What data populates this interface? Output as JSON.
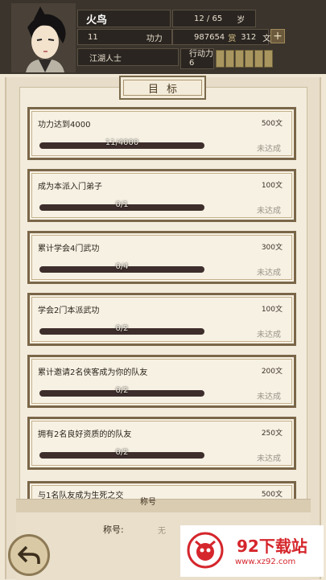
{
  "player": {
    "name": "火鸟",
    "age": "12 / 65",
    "age_unit": "岁",
    "level": "11",
    "power_label": "功力",
    "power": "987654",
    "currency_label": "赏",
    "coins": "312",
    "coin_unit": "文",
    "identity": "江湖人士",
    "action_label": "行动力",
    "action_value": "6",
    "action_points_filled": 6,
    "action_points_total": 6
  },
  "panel": {
    "title": "目标"
  },
  "goals": [
    {
      "text": "功力达到4000",
      "reward": "500文",
      "progress_text": "11/4000",
      "progress": 0.00275,
      "status": "未达成"
    },
    {
      "text": "成为本派入门弟子",
      "reward": "100文",
      "progress_text": "0/1",
      "progress": 0,
      "status": "未达成"
    },
    {
      "text": "累计学会4门武功",
      "reward": "300文",
      "progress_text": "0/4",
      "progress": 0,
      "status": "未达成"
    },
    {
      "text": "学会2门本派武功",
      "reward": "100文",
      "progress_text": "0/2",
      "progress": 0,
      "status": "未达成"
    },
    {
      "text": "累计邀请2名侠客成为你的队友",
      "reward": "200文",
      "progress_text": "0/2",
      "progress": 0,
      "status": "未达成"
    },
    {
      "text": "拥有2名良好资质的的队友",
      "reward": "250文",
      "progress_text": "0/2",
      "progress": 0,
      "status": "未达成"
    }
  ],
  "partial_goal": {
    "text": "与1名队友成为生死之交",
    "reward": "500文"
  },
  "title_section": {
    "header": "称号",
    "label": "称号:",
    "value": "无"
  },
  "watermark": {
    "name": "92下载站",
    "url": "www.xz92.com"
  },
  "colors": {
    "header_bg": "#3a342c",
    "card_border": "#7a6648",
    "bar_color": "#3d2e2c",
    "status_color": "#9b9488",
    "watermark_red": "#d5262c"
  }
}
